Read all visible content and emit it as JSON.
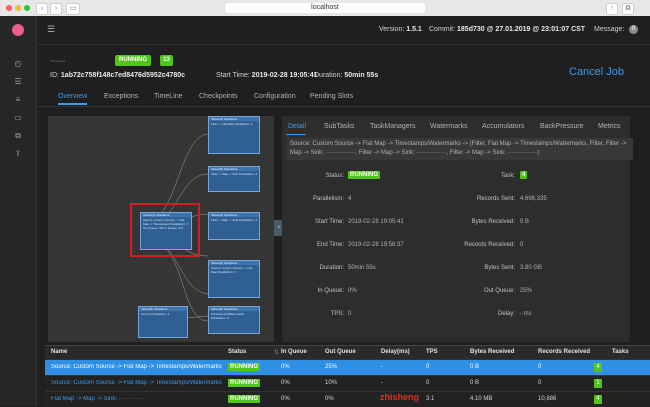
{
  "browser": {
    "url": "localhost"
  },
  "rail": {
    "icons": [
      "dashboard-icon",
      "list-icon",
      "menu-icon",
      "card-icon",
      "layers-icon",
      "upload-icon"
    ]
  },
  "header": {
    "version_label": "Version:",
    "version": "1.5.1",
    "commit_label": "Commit:",
    "commit": "185d730 @ 27.01.2019 @ 23:01:07 CST",
    "message_label": "Message:",
    "message_count": "0"
  },
  "job": {
    "name": "···········",
    "status": "RUNNING",
    "running_count": "13",
    "id_label": "ID:",
    "id": "1ab72c758f148c7ed8476d5952c4780c",
    "start_label": "Start Time:",
    "start": "2019-02-28 19:05:41",
    "duration_label": "Duration:",
    "duration": "50min 55s",
    "cancel": "Cancel Job"
  },
  "tabs": [
    "Overview",
    "Exceptions",
    "TimeLine",
    "Checkpoints",
    "Configuration",
    "Pending Slots"
  ],
  "graph": {
    "nodes": [
      {
        "id": "n1",
        "head": "Vertex(1) Operators",
        "body": "Source: Custom Source -> Flat Map -> Timestamps Parallelism: 4 Out Queue: 0% In Queue: 0%"
      },
      {
        "id": "n2",
        "head": "Vertex(2) Operators",
        "body": "Filter -> Flat Map Parallelism: 4"
      },
      {
        "id": "n3",
        "head": "Vertex(3) Operators",
        "body": "Filter -> Map -> Sink Parallelism: 4"
      },
      {
        "id": "n4",
        "head": "Vertex(4) Operators",
        "body": "Filter -> Map -> Sink Parallelism: 4"
      },
      {
        "id": "n5",
        "head": "Vertex(5) Operators",
        "body": "Source: Custom Source -> Flat Map Parallelism: 4"
      },
      {
        "id": "n6",
        "head": "Vertex(6) Operators",
        "body": "Timestamps/Watermarks Parallelism: 4"
      },
      {
        "id": "n7",
        "head": "Vertex(7) Operators",
        "body": "Flat Map -> Sink Parallelism: 4"
      },
      {
        "id": "n8",
        "head": "Vertex(8) Operators",
        "body": "Source Parallelism: 4"
      }
    ]
  },
  "panel": {
    "tabs": [
      "Detail",
      "SubTasks",
      "TaskManagers",
      "Watermarks",
      "Accumulators",
      "BackPressure",
      "Metrics"
    ],
    "description": "Source: Custom Source -> Flat Map -> Timestamps/Watermarks -> (Filter, Flat Map -> Timestamps/Watermarks, Filter, Filter -> Map -> Sink: ···············, Filter -> Map -> Sink: ···············, Filter -> Map -> Sink: ···············)",
    "status_label": "Status:",
    "status": "RUNNING",
    "task_label": "Task:",
    "task": "4",
    "parallelism_label": "Parallelism:",
    "parallelism": "4",
    "records_sent_label": "Records Sent:",
    "records_sent": "4,696,335",
    "start_label": "Start Time:",
    "start": "2019-02-28 19:05:41",
    "bytes_received_label": "Bytes Received:",
    "bytes_received": "0 B",
    "end_label": "End Time:",
    "end": "2019-02-28 19:56:37",
    "records_received_label": "Records Received:",
    "records_received": "0",
    "duration_label": "Duration:",
    "duration": "50min 55s",
    "bytes_sent_label": "Bytes Sent:",
    "bytes_sent": "3.80 GB",
    "in_queue_label": "In Queue:",
    "in_queue": "0%",
    "out_queue_label": "Out Queue:",
    "out_queue": "25%",
    "tps_label": "TPS:",
    "tps": "0",
    "delay_label": "Delay:",
    "delay": "- ms"
  },
  "table": {
    "headers": [
      "Name",
      "Status",
      "In Queue",
      "Out Queue",
      "Delay(ms)",
      "TPS",
      "Bytes Received",
      "Records Received",
      "Tasks"
    ],
    "rows": [
      {
        "name": "Source: Custom Source -> Flat Map -> Timestamps/Watermarks -> ...",
        "status": "RUNNING",
        "in_queue": "0%",
        "out_queue": "25%",
        "delay": "-",
        "tps": "0",
        "bytes_received": "0 B",
        "records_received": "0",
        "tasks": "4"
      },
      {
        "name": "Source: Custom Source -> Flat Map -> Timestamps/Watermarks",
        "status": "RUNNING",
        "in_queue": "0%",
        "out_queue": "10%",
        "delay": "-",
        "tps": "0",
        "bytes_received": "0 B",
        "records_received": "0",
        "tasks": "1"
      },
      {
        "name": "Flat Map -> Map -> Sink: ······ ······",
        "status": "RUNNING",
        "in_queue": "0%",
        "out_queue": "0%",
        "delay": "",
        "tps": "3.1",
        "bytes_received": "4.10 MB",
        "records_received": "10,886",
        "tasks": "4"
      }
    ]
  },
  "watermark": "zhisheng",
  "colors": {
    "accent": "#3d9be9",
    "running": "#52c41a",
    "highlight": "#d0201f"
  }
}
